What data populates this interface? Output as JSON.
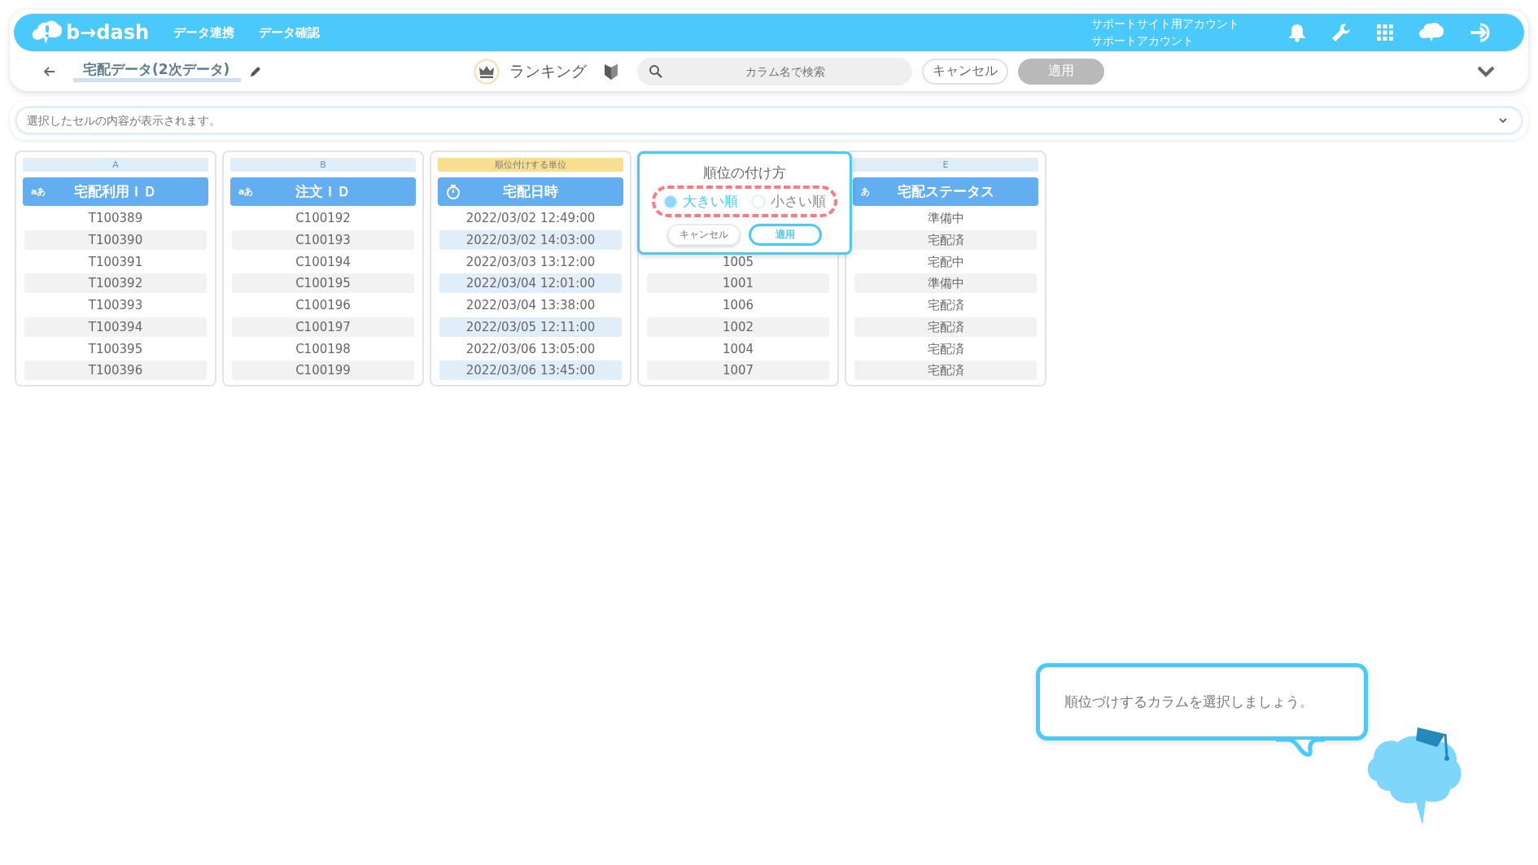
{
  "header": {
    "logo": "b→dash",
    "nav": [
      "データ連携",
      "データ確認"
    ],
    "account": [
      "サポートサイト用アカウント",
      "サポートアカウント"
    ]
  },
  "toolbar": {
    "title": "宅配データ(2次データ)",
    "mode": "ランキング",
    "search": {
      "placeholder": "カラム名で検索"
    },
    "buttons": [
      {
        "label": "キャンセル",
        "kind": "outline"
      },
      {
        "label": "適用",
        "kind": "disabled"
      }
    ]
  },
  "cell_preview": {
    "placeholder": "選択したセルの内容が表示されます。"
  },
  "columns": [
    {
      "letter": "A",
      "kind": "text",
      "type": "aあ",
      "header": "宅配利用ＩＤ",
      "selected": false,
      "cells": [
        "T100389",
        "T100390",
        "T100391",
        "T100392",
        "T100393",
        "T100394",
        "T100395",
        "T100396"
      ]
    },
    {
      "letter": "B",
      "kind": "text",
      "type": "aあ",
      "header": "注文ＩＤ",
      "selected": false,
      "cells": [
        "C100192",
        "C100193",
        "C100194",
        "C100195",
        "C100196",
        "C100197",
        "C100198",
        "C100199"
      ]
    },
    {
      "letter": "順位付けする単位",
      "kind": "datetime",
      "header": "宅配日時",
      "selected": true,
      "cells": [
        "2022/03/02 12:49:00",
        "2022/03/02 14:03:00",
        "2022/03/03 13:12:00",
        "2022/03/04 12:01:00",
        "2022/03/04 13:38:00",
        "2022/03/05 12:11:00",
        "2022/03/06 13:05:00",
        "2022/03/06 13:45:00"
      ]
    },
    {
      "kind": "covered",
      "selected": false,
      "cells": [
        "1005",
        "1001",
        "1006",
        "1002",
        "1004",
        "1007"
      ]
    },
    {
      "letter": "E",
      "kind": "text",
      "type": "あ",
      "header": "宅配ステータス",
      "selected": false,
      "cells": [
        "準備中",
        "宅配済",
        "宅配中",
        "準備中",
        "宅配済",
        "宅配済",
        "宅配済",
        "宅配済"
      ]
    }
  ],
  "popover": {
    "title": "順位の付け方",
    "options": [
      {
        "label": "大きい順",
        "selected": true
      },
      {
        "label": "小さい順",
        "selected": false
      }
    ],
    "buttons": [
      {
        "label": "キャンセル",
        "kind": "outline"
      },
      {
        "label": "適用",
        "kind": "primary"
      }
    ]
  },
  "guide": {
    "message": "順位づけするカラムを選択しましょう。"
  }
}
